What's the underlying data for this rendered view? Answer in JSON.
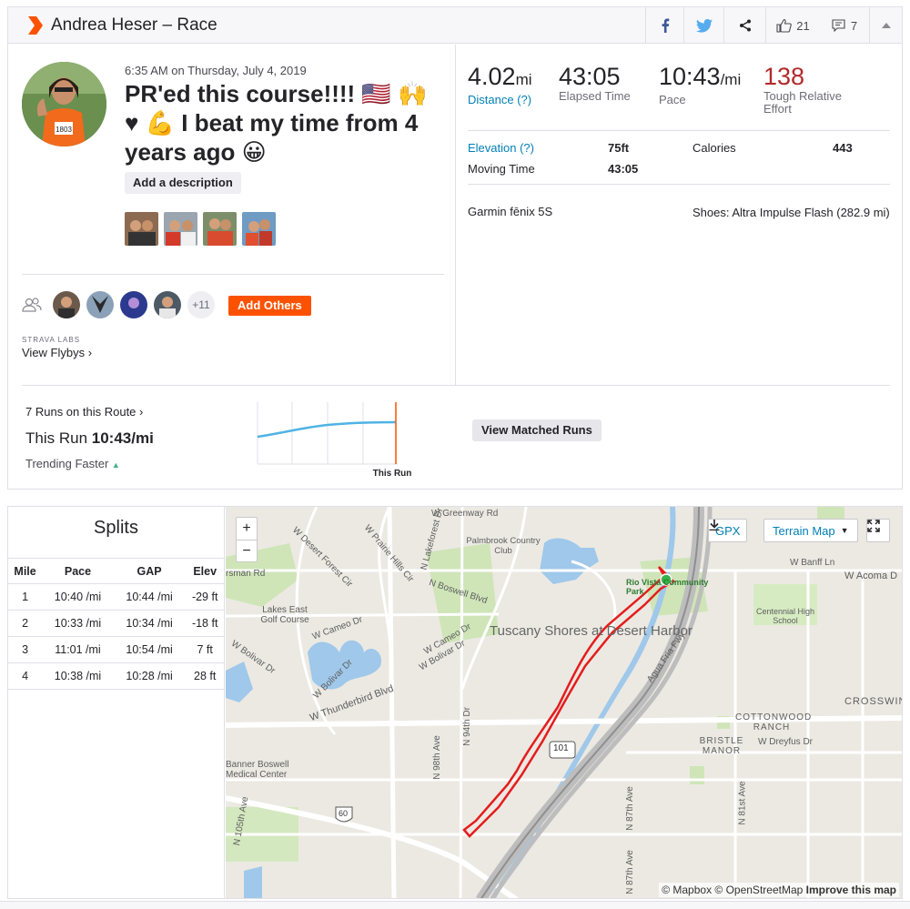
{
  "header": {
    "title": "Andrea Heser – Race",
    "kudos_count": "21",
    "comments_count": "7",
    "brand_color": "#fc5200"
  },
  "activity": {
    "datetime": "6:35 AM on Thursday, July 4, 2019",
    "name": "PR'ed this course!!!! 🇺🇸 🙌 ♥ 💪 I beat my time from 4 years ago 😀",
    "add_description": "Add a description",
    "add_others": "Add Others",
    "more_athletes": "+11",
    "labs_label": "STRAVA LABS",
    "flybys": "View Flybys ›"
  },
  "stats": {
    "distance": "4.02",
    "distance_unit": "mi",
    "distance_label": "Distance (?)",
    "elapsed": "43:05",
    "elapsed_label": "Elapsed Time",
    "pace": "10:43",
    "pace_unit": "/mi",
    "pace_label": "Pace",
    "effort": "138",
    "effort_label": "Tough Relative Effort",
    "elevation_label": "Elevation (?)",
    "elevation": "75ft",
    "calories_label": "Calories",
    "calories": "443",
    "moving_label": "Moving Time",
    "moving": "43:05",
    "device": "Garmin fēnix 5S",
    "shoes": "Shoes: Altra Impulse Flash (282.9 mi)"
  },
  "matched": {
    "runs_on_route": "7 Runs on this Route ›",
    "this_run_label": "This Run ",
    "this_run_pace": "10:43/mi",
    "trend": "Trending Faster",
    "chart_marker": "This Run",
    "button": "View Matched Runs"
  },
  "splits": {
    "title": "Splits",
    "headers": [
      "Mile",
      "Pace",
      "GAP",
      "Elev"
    ],
    "rows": [
      [
        "1",
        "10:40 /mi",
        "10:44 /mi",
        "-29 ft"
      ],
      [
        "2",
        "10:33 /mi",
        "10:34 /mi",
        "-18 ft"
      ],
      [
        "3",
        "11:01 /mi",
        "10:54 /mi",
        "7 ft"
      ],
      [
        "4",
        "10:38 /mi",
        "10:28 /mi",
        "28 ft"
      ]
    ]
  },
  "map": {
    "gpx": "GPX",
    "terrain": "Terrain Map",
    "attribution": "© Mapbox © OpenStreetMap ",
    "improve": "Improve this map",
    "labels": {
      "greenway": "W Greenway Rd",
      "banff": "W Banff Ln",
      "acoma": "W Acoma D",
      "tuscany": "Tuscany Shores at Desert Harbor",
      "riovista": "Rio Vista Community Park",
      "centennial": "Centennial High School",
      "palmbrook": "Palmbrook Country Club",
      "lakes": "Lakes East Golf Course",
      "cameo": "W Cameo Dr",
      "bolivar": "W Bolivar Dr",
      "thunderbird": "W Thunderbird Blvd",
      "boswell": "N Boswell Blvd",
      "cottonwood": "COTTONWOOD RANCH",
      "bristle": "BRISTLE MANOR",
      "dreyfus": "W Dreyfus Dr",
      "crosswind": "CROSSWIND",
      "agua": "Agua Fria Fwy",
      "hwy101": "101",
      "hwy60": "60",
      "ave87": "N 87th Ave",
      "ave81": "N 81st Ave",
      "dr94": "N 94th Dr",
      "ave98": "N 98th Ave",
      "ave105": "N 105th Ave",
      "medical": "Banner Boswell Medical Center",
      "desertforest": "W Desert Forest Cir",
      "prairie": "W Prairie Hills Cir",
      "lakeforest": "N Lakeforest Dr",
      "rsman": "rsman Rd"
    }
  }
}
